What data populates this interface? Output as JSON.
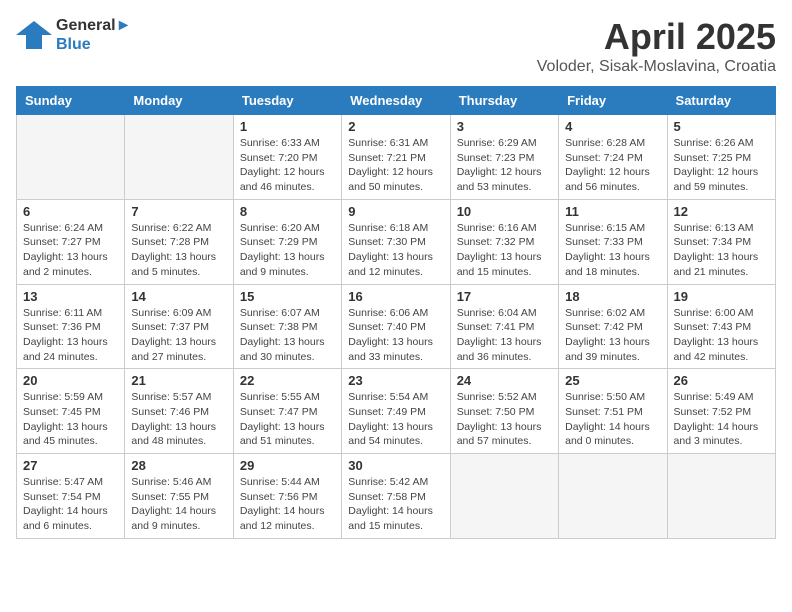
{
  "header": {
    "logo_line1": "General",
    "logo_line2": "Blue",
    "month_title": "April 2025",
    "location": "Voloder, Sisak-Moslavina, Croatia"
  },
  "days_of_week": [
    "Sunday",
    "Monday",
    "Tuesday",
    "Wednesday",
    "Thursday",
    "Friday",
    "Saturday"
  ],
  "weeks": [
    [
      {
        "day": "",
        "empty": true
      },
      {
        "day": "",
        "empty": true
      },
      {
        "day": "1",
        "sunrise": "6:33 AM",
        "sunset": "7:20 PM",
        "daylight": "12 hours and 46 minutes."
      },
      {
        "day": "2",
        "sunrise": "6:31 AM",
        "sunset": "7:21 PM",
        "daylight": "12 hours and 50 minutes."
      },
      {
        "day": "3",
        "sunrise": "6:29 AM",
        "sunset": "7:23 PM",
        "daylight": "12 hours and 53 minutes."
      },
      {
        "day": "4",
        "sunrise": "6:28 AM",
        "sunset": "7:24 PM",
        "daylight": "12 hours and 56 minutes."
      },
      {
        "day": "5",
        "sunrise": "6:26 AM",
        "sunset": "7:25 PM",
        "daylight": "12 hours and 59 minutes."
      }
    ],
    [
      {
        "day": "6",
        "sunrise": "6:24 AM",
        "sunset": "7:27 PM",
        "daylight": "13 hours and 2 minutes."
      },
      {
        "day": "7",
        "sunrise": "6:22 AM",
        "sunset": "7:28 PM",
        "daylight": "13 hours and 5 minutes."
      },
      {
        "day": "8",
        "sunrise": "6:20 AM",
        "sunset": "7:29 PM",
        "daylight": "13 hours and 9 minutes."
      },
      {
        "day": "9",
        "sunrise": "6:18 AM",
        "sunset": "7:30 PM",
        "daylight": "13 hours and 12 minutes."
      },
      {
        "day": "10",
        "sunrise": "6:16 AM",
        "sunset": "7:32 PM",
        "daylight": "13 hours and 15 minutes."
      },
      {
        "day": "11",
        "sunrise": "6:15 AM",
        "sunset": "7:33 PM",
        "daylight": "13 hours and 18 minutes."
      },
      {
        "day": "12",
        "sunrise": "6:13 AM",
        "sunset": "7:34 PM",
        "daylight": "13 hours and 21 minutes."
      }
    ],
    [
      {
        "day": "13",
        "sunrise": "6:11 AM",
        "sunset": "7:36 PM",
        "daylight": "13 hours and 24 minutes."
      },
      {
        "day": "14",
        "sunrise": "6:09 AM",
        "sunset": "7:37 PM",
        "daylight": "13 hours and 27 minutes."
      },
      {
        "day": "15",
        "sunrise": "6:07 AM",
        "sunset": "7:38 PM",
        "daylight": "13 hours and 30 minutes."
      },
      {
        "day": "16",
        "sunrise": "6:06 AM",
        "sunset": "7:40 PM",
        "daylight": "13 hours and 33 minutes."
      },
      {
        "day": "17",
        "sunrise": "6:04 AM",
        "sunset": "7:41 PM",
        "daylight": "13 hours and 36 minutes."
      },
      {
        "day": "18",
        "sunrise": "6:02 AM",
        "sunset": "7:42 PM",
        "daylight": "13 hours and 39 minutes."
      },
      {
        "day": "19",
        "sunrise": "6:00 AM",
        "sunset": "7:43 PM",
        "daylight": "13 hours and 42 minutes."
      }
    ],
    [
      {
        "day": "20",
        "sunrise": "5:59 AM",
        "sunset": "7:45 PM",
        "daylight": "13 hours and 45 minutes."
      },
      {
        "day": "21",
        "sunrise": "5:57 AM",
        "sunset": "7:46 PM",
        "daylight": "13 hours and 48 minutes."
      },
      {
        "day": "22",
        "sunrise": "5:55 AM",
        "sunset": "7:47 PM",
        "daylight": "13 hours and 51 minutes."
      },
      {
        "day": "23",
        "sunrise": "5:54 AM",
        "sunset": "7:49 PM",
        "daylight": "13 hours and 54 minutes."
      },
      {
        "day": "24",
        "sunrise": "5:52 AM",
        "sunset": "7:50 PM",
        "daylight": "13 hours and 57 minutes."
      },
      {
        "day": "25",
        "sunrise": "5:50 AM",
        "sunset": "7:51 PM",
        "daylight": "14 hours and 0 minutes."
      },
      {
        "day": "26",
        "sunrise": "5:49 AM",
        "sunset": "7:52 PM",
        "daylight": "14 hours and 3 minutes."
      }
    ],
    [
      {
        "day": "27",
        "sunrise": "5:47 AM",
        "sunset": "7:54 PM",
        "daylight": "14 hours and 6 minutes."
      },
      {
        "day": "28",
        "sunrise": "5:46 AM",
        "sunset": "7:55 PM",
        "daylight": "14 hours and 9 minutes."
      },
      {
        "day": "29",
        "sunrise": "5:44 AM",
        "sunset": "7:56 PM",
        "daylight": "14 hours and 12 minutes."
      },
      {
        "day": "30",
        "sunrise": "5:42 AM",
        "sunset": "7:58 PM",
        "daylight": "14 hours and 15 minutes."
      },
      {
        "day": "",
        "empty": true
      },
      {
        "day": "",
        "empty": true
      },
      {
        "day": "",
        "empty": true
      }
    ]
  ]
}
